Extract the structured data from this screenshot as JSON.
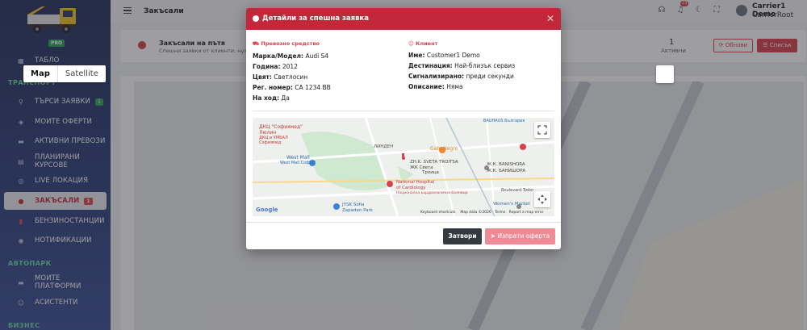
{
  "sidebar": {
    "pro_badge": "PRO",
    "dashboard": "ТАБЛО",
    "sections": {
      "transport": "ТРАНСПОРТ",
      "fleet": "АВТОПАРК",
      "business": "БИЗНЕС"
    },
    "items": [
      {
        "label": "ТЪРСИ ЗАЯВКИ",
        "count": "1",
        "icon": "search-icon"
      },
      {
        "label": "МОИТЕ ОФЕРТИ",
        "icon": "tag-icon"
      },
      {
        "label": "АКТИВНИ ПРЕВОЗИ",
        "icon": "truck-icon"
      },
      {
        "label": "ПЛАНИРАНИ КУРСОВЕ",
        "icon": "calendar-icon"
      },
      {
        "label": "LIVE ЛОКАЦИЯ",
        "icon": "target-icon"
      },
      {
        "label": "ЗАКЪСАЛИ",
        "count": "1",
        "icon": "alert-icon"
      },
      {
        "label": "БЕНЗИНОСТАНЦИИ",
        "icon": "fuel-icon"
      },
      {
        "label": "НОТИФИКАЦИИ",
        "icon": "bell-icon"
      }
    ],
    "fleet_items": [
      {
        "label": "МОИТЕ ПЛАТФОРМИ",
        "icon": "truck-icon"
      },
      {
        "label": "АСИСТЕНТИ",
        "icon": "user-icon"
      }
    ]
  },
  "topbar": {
    "title": "Закъсали",
    "notif_count": "23",
    "user_name": "Carrier1 Demo",
    "user_role": "CarrierRoot"
  },
  "page": {
    "card_title": "Закъсали на пътя",
    "card_sub": "Спешни заявки от клиенти, нуждае",
    "active_count": "1",
    "active_label": "Активни",
    "refresh": "Обнови",
    "list": "Списък",
    "map_types": [
      "Map",
      "Satellite"
    ]
  },
  "modal": {
    "title": "Детайли за спешна заявка",
    "vehicle_header": "Превозно средство",
    "client_header": "Клиент",
    "vehicle": [
      {
        "k": "Марка/Модел:",
        "v": "Audi S4"
      },
      {
        "k": "Година:",
        "v": "2012"
      },
      {
        "k": "Цвят:",
        "v": "Светлосин"
      },
      {
        "k": "Рег. номер:",
        "v": "CA 1234 BB"
      },
      {
        "k": "На ход:",
        "v": "Да"
      }
    ],
    "client": [
      {
        "k": "Име:",
        "v": "Customer1 Demo"
      },
      {
        "k": "Дестинация:",
        "v": "Най-близък сервиз"
      },
      {
        "k": "Сигнализирано:",
        "v": "преди секунди"
      },
      {
        "k": "Описание:",
        "v": "Няма"
      }
    ],
    "map_labels": {
      "poi1": "ДКЦ \"Софиямед\"",
      "poi1b": "Люлин",
      "poi1c": "ДКЦ и УМБАЛ",
      "poi1d": "Софиямед",
      "westmall": "West Mall",
      "westmall2": "West Mall София",
      "gato": "Gato Negro",
      "troitsa": "ЖК Света",
      "troitsa2": "Троица",
      "troitsa3": "ZH.K. SVETA TROITSA",
      "banishora": "Ж.К. BANISHORA",
      "banishora2": "Ж.К. БАНИШОРА",
      "hospital": "National Hospital",
      "hospital2": "of Cardiology",
      "hospital3": "Национална кардиологична болница",
      "jysk": "JYSK Sofia",
      "jysk2": "Zapaden Park",
      "womens": "Women's Market",
      "lyulin": "ЛИНДЕН",
      "bauhaus": "BAUHAUS България",
      "bvd": "Boulevard Todor",
      "google": "Google",
      "shortcuts": "Keyboard shortcuts",
      "mapdata": "Map data ©2026",
      "terms": "Terms",
      "report": "Report a map error"
    },
    "close": "Затвори",
    "send_offer": "Изпрати оферта"
  },
  "colors": {
    "accent": "#c3283a",
    "sidebar": "#2d3f7c",
    "green": "#2ea45a"
  }
}
